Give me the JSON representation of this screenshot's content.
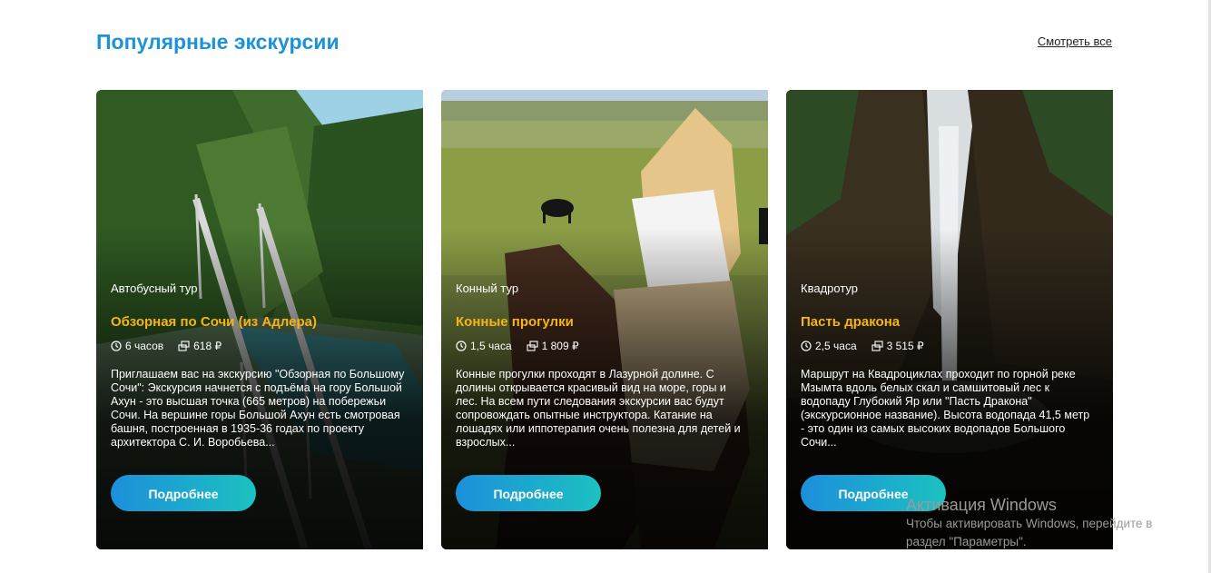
{
  "header": {
    "title": "Популярные экскурсии",
    "see_all": "Смотреть все"
  },
  "cards": [
    {
      "category": "Автобусный тур",
      "title": "Обзорная по Сочи (из Адлера)",
      "duration": "6 часов",
      "price": "618 ₽",
      "description": "Приглашаем вас на экскурсию \"Обзорная по Большому Сочи\": Экскурсия начнется с подъёма на гору Большой Ахун - это высшая точка (665 метров) на побережьи Сочи. На вершине горы Большой Ахун есть смотровая башня, построенная в 1935-36 годах по проекту архитектора С. И. Воробьева...",
      "button": "Подробнее"
    },
    {
      "category": "Конный тур",
      "title": "Конные прогулки",
      "duration": "1,5 часа",
      "price": "1 809 ₽",
      "description": "Конные прогулки проходят в Лазурной долине. С долины открывается красивый вид на море, горы и лес. На всем пути следования экскурсии вас будут сопровождать опытные инструктора. Катание на лошадях или иппотерапия очень полезна для детей и взрослых...",
      "button": "Подробнее"
    },
    {
      "category": "Квадротур",
      "title": "Пасть дракона",
      "duration": "2,5 часа",
      "price": "3 515 ₽",
      "description": "Маршрут на Квадроциклах проходит по горной реке Мзымта вдоль белых скал и самшитовый лес к водопаду Глубокий Яр или \"Пасть Дракона\" (экскурсионное название). Высота водопада 41,5 метр - это один из самых высоких водопадов Большого Сочи...",
      "button": "Подробнее"
    }
  ],
  "watermark": {
    "line1": "Активация Windows",
    "line2": "Чтобы активировать Windows, перейдите в",
    "line3": "раздел \"Параметры\"."
  },
  "colors": {
    "title": "#1c93d6",
    "card_title": "#f6b512",
    "button_start": "#1d8fdb",
    "button_end": "#1cc1c1"
  }
}
